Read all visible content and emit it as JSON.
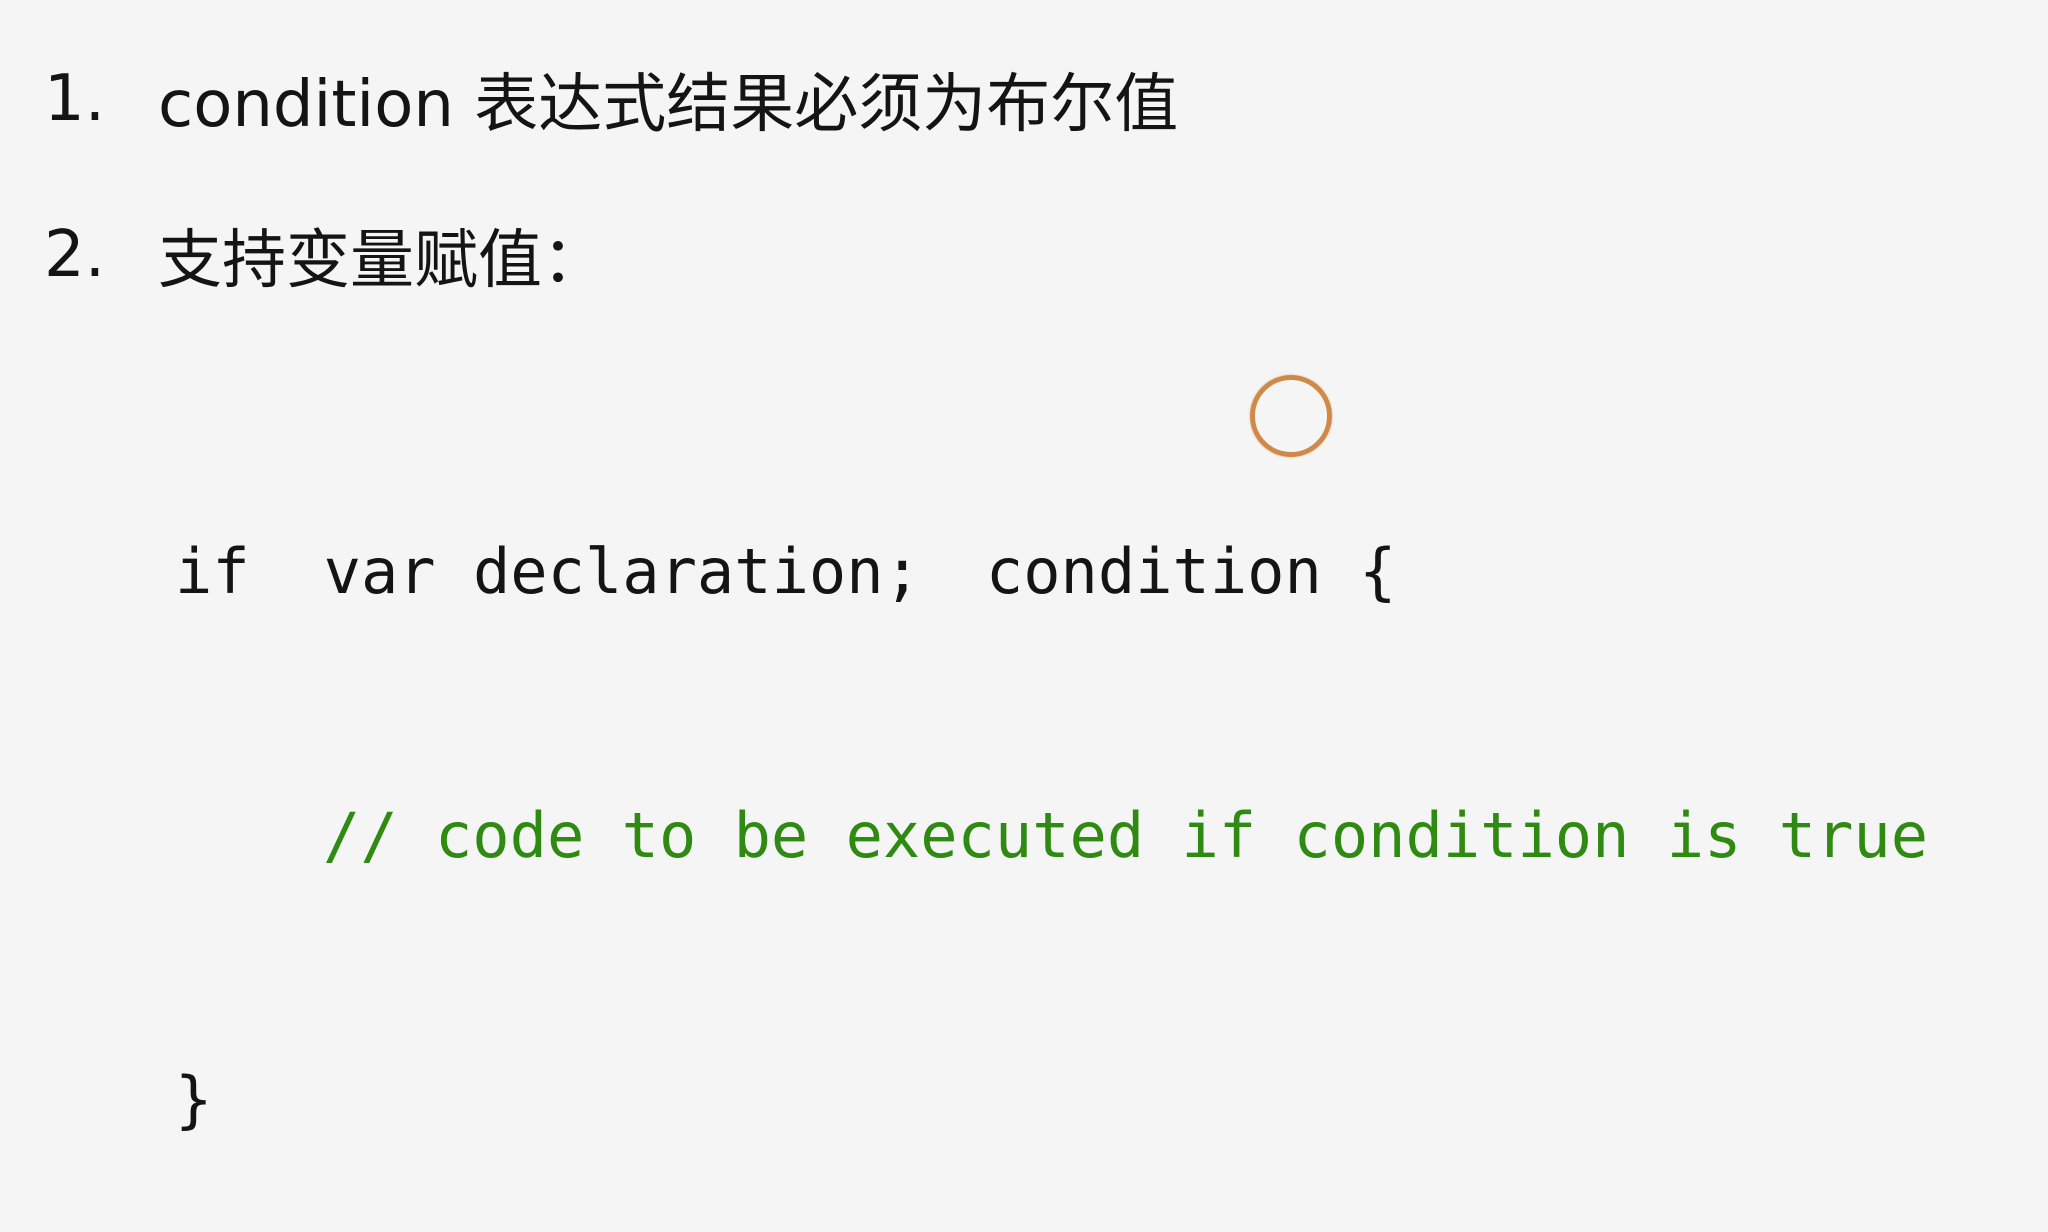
{
  "list": [
    {
      "number": "1.",
      "text": "condition 表达式结果必须为布尔值"
    },
    {
      "number": "2.",
      "text": "支持变量赋值："
    }
  ],
  "code": {
    "line1": {
      "keyword": "if",
      "declaration": "var declaration;",
      "condition": "condition {"
    },
    "line2_comment": "// code to be executed if condition is true",
    "line3": "}"
  },
  "colors": {
    "background": "#f5f5f5",
    "text": "#141414",
    "comment": "#2f8a12",
    "cursor_ring": "#cf8a4a"
  }
}
